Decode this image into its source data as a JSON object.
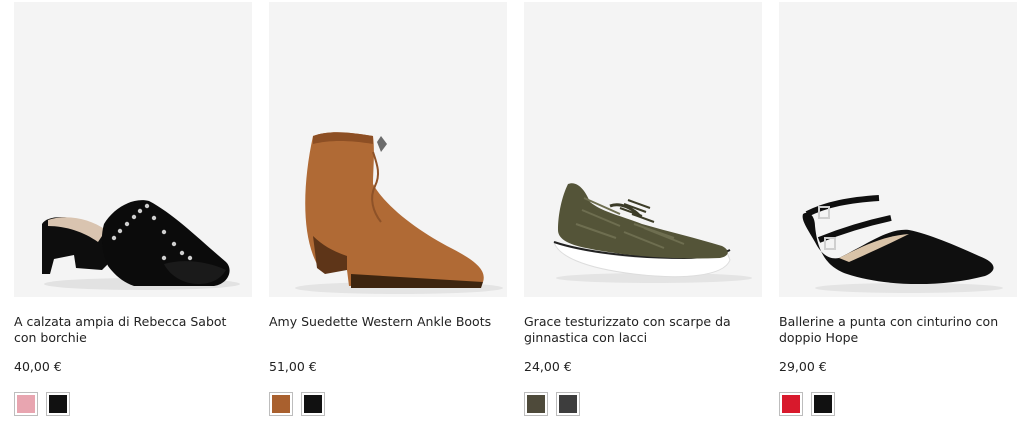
{
  "products": [
    {
      "name": "A calzata ampia di Rebecca Sabot con borchie",
      "price": "40,00 €",
      "colors": [
        "#e8a5b0",
        "#111111"
      ]
    },
    {
      "name": "Amy Suedette Western Ankle Boots",
      "price": "51,00 €",
      "colors": [
        "#a9602e",
        "#111111"
      ]
    },
    {
      "name": "Grace testurizzato con scarpe da ginnastica con lacci",
      "price": "24,00 €",
      "colors": [
        "#4e4a3a",
        "#3d3d3d"
      ]
    },
    {
      "name": "Ballerine a punta con cinturino con doppio Hope",
      "price": "29,00 €",
      "colors": [
        "#d8192c",
        "#111111"
      ]
    }
  ]
}
